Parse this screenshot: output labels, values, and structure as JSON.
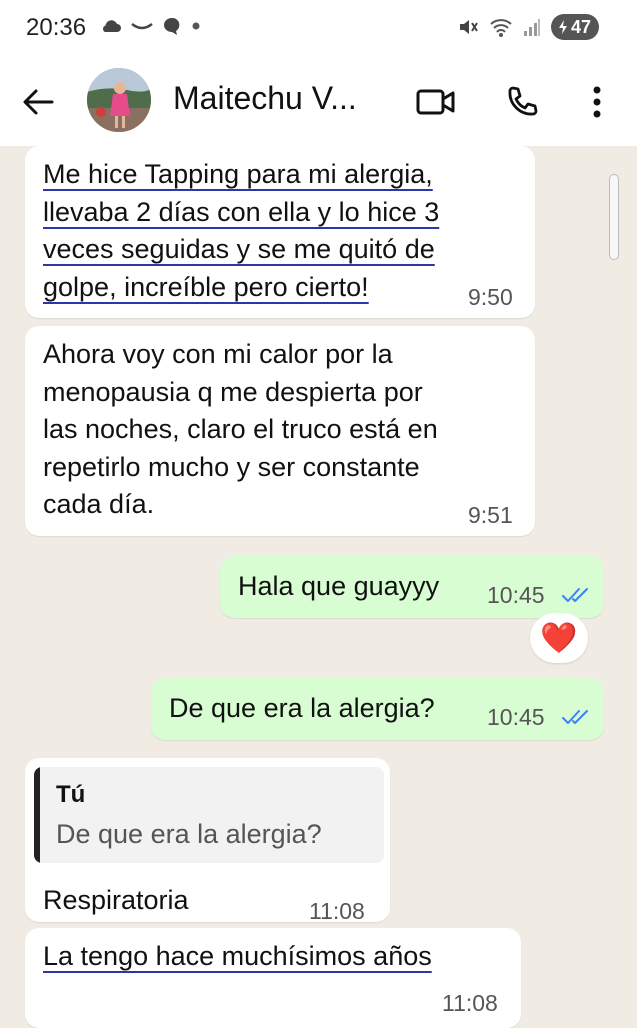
{
  "status_bar": {
    "time": "20:36",
    "battery": "47",
    "icons": [
      "cloud-icon",
      "smile-icon",
      "chat-bubble-icon",
      "dot-icon",
      "mute-icon",
      "wifi-icon",
      "signal-icon",
      "battery-icon"
    ]
  },
  "header": {
    "contact_name": "Maitechu V...",
    "icons": [
      "back-arrow-icon",
      "video-call-icon",
      "phone-icon",
      "more-vertical-icon"
    ]
  },
  "messages": [
    {
      "direction": "incoming",
      "lines": [
        "Me hice Tapping para mi alergia,",
        "llevaba 2 días con ella y lo hice 3",
        "veces seguidas y se me quitó de",
        "golpe, increíble pero cierto!"
      ],
      "time": "9:50",
      "underlined": true
    },
    {
      "direction": "incoming",
      "lines": [
        "Ahora voy con mi calor por la",
        "menopausia q me despierta por",
        "las noches, claro el truco está en",
        "repetirlo mucho y ser constante",
        "cada día."
      ],
      "time": "9:51"
    },
    {
      "direction": "outgoing",
      "text": "Hala que guayyy",
      "time": "10:45",
      "status": "read",
      "reaction": "❤️"
    },
    {
      "direction": "outgoing",
      "text": "De que era la alergia?",
      "time": "10:45",
      "status": "read"
    },
    {
      "direction": "incoming",
      "quote": {
        "author": "Tú",
        "text": "De que era la alergia?"
      },
      "text": "Respiratoria",
      "time": "11:08"
    },
    {
      "direction": "incoming",
      "text": "La tengo hace muchísimos años",
      "time": "11:08",
      "underlined": true
    }
  ],
  "colors": {
    "chat_background": "#f0ebe3",
    "outgoing_bubble": "#d9fdd3",
    "incoming_bubble": "#ffffff",
    "read_ticks": "#3b82f6",
    "underline": "#2a37a8"
  }
}
